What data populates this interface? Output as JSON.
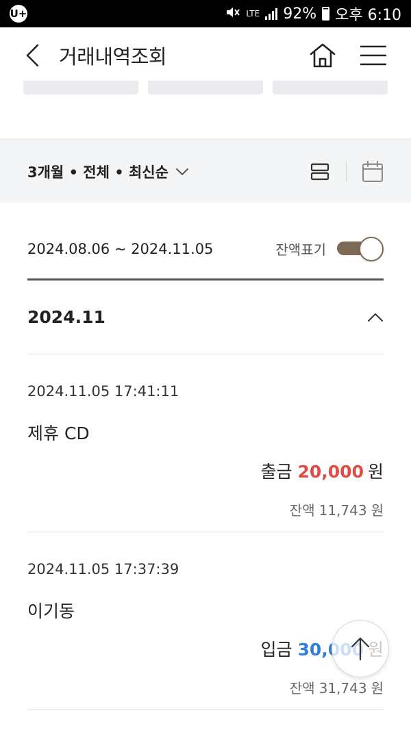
{
  "statusbar": {
    "carrier_icon": "U+",
    "lte": "LTE",
    "battery": "92%",
    "time": "오후 6:10"
  },
  "header": {
    "title": "거래내역조회"
  },
  "filter": {
    "summary": "3개월 • 전체 • 최신순"
  },
  "period": {
    "range": "2024.08.06 ~ 2024.11.05",
    "balance_toggle_label": "잔액표기",
    "balance_toggle_on": true
  },
  "month": {
    "label": "2024.11"
  },
  "transactions": [
    {
      "datetime": "2024.11.05 17:41:11",
      "name": "제휴 CD",
      "type": "출금",
      "amount": "20,000",
      "currency": "원",
      "balance_label": "잔액",
      "balance": "11,743",
      "balance_currency": "원"
    },
    {
      "datetime": "2024.11.05 17:37:39",
      "name": "이기동",
      "type": "입금",
      "amount": "30,000",
      "currency": "원",
      "balance_label": "잔액",
      "balance": "31,743",
      "balance_currency": "원"
    }
  ],
  "colors": {
    "withdraw": "#e04b45",
    "deposit": "#2f7fdc",
    "toggle": "#7c6a56"
  }
}
